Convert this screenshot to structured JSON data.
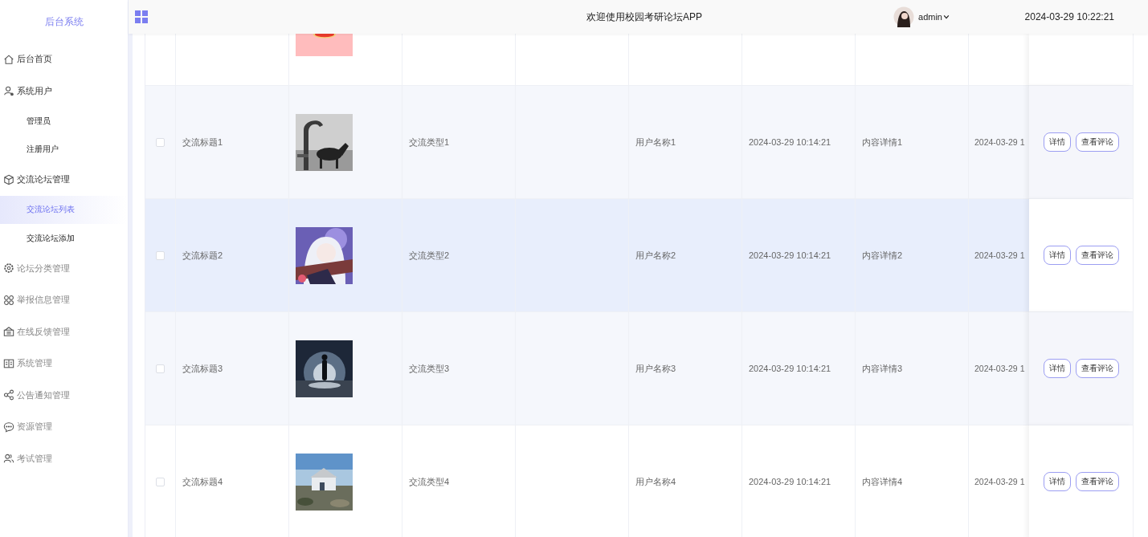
{
  "sidebar": {
    "title": "后台系统",
    "items": [
      {
        "label": "后台首页",
        "selected": false
      },
      {
        "label": "系统用户",
        "selected": false,
        "children": [
          {
            "label": "管理员",
            "selected": false
          },
          {
            "label": "注册用户",
            "selected": false
          }
        ]
      },
      {
        "label": "交流论坛管理",
        "selected": false,
        "children": [
          {
            "label": "交流论坛列表",
            "selected": true
          },
          {
            "label": "交流论坛添加",
            "selected": false
          }
        ]
      },
      {
        "label": "论坛分类管理",
        "selected": false
      },
      {
        "label": "举报信息管理",
        "selected": false
      },
      {
        "label": "在线反馈管理",
        "selected": false
      },
      {
        "label": "系统管理",
        "selected": false
      },
      {
        "label": "公告通知管理",
        "selected": false
      },
      {
        "label": "资源管理",
        "selected": false
      },
      {
        "label": "考试管理",
        "selected": false
      }
    ]
  },
  "header": {
    "title": "欢迎使用校园考研论坛APP",
    "user": "admin",
    "datetime": "2024-03-29 10:22:21"
  },
  "table": {
    "rows": [
      {
        "kind": "partial"
      },
      {
        "kind": "full",
        "checked": false,
        "hovered": false,
        "title": "交流标题1",
        "type": "交流类型1",
        "user": "用户名称1",
        "time": "2024-03-29 10:14:21",
        "content": "内容详情1",
        "time_2": "2024-03-29 1",
        "buttons": [
          "详情",
          "查看评论"
        ]
      },
      {
        "kind": "full",
        "checked": false,
        "hovered": true,
        "title": "交流标题2",
        "type": "交流类型2",
        "user": "用户名称2",
        "time": "2024-03-29 10:14:21",
        "content": "内容详情2",
        "time_2": "2024-03-29 1",
        "buttons": [
          "详情",
          "查看评论"
        ]
      },
      {
        "kind": "full",
        "checked": false,
        "hovered": false,
        "title": "交流标题3",
        "type": "交流类型3",
        "user": "用户名称3",
        "time": "2024-03-29 10:14:21",
        "content": "内容详情3",
        "time_2": "2024-03-29 1",
        "buttons": [
          "详情",
          "查看评论"
        ]
      },
      {
        "kind": "full",
        "checked": false,
        "hovered": false,
        "title": "交流标题4",
        "type": "交流类型4",
        "user": "用户名称4",
        "time": "2024-03-29 10:14:21",
        "content": "内容详情4",
        "time_2": "2024-03-29 1",
        "buttons": [
          "详情",
          "查看评论"
        ]
      }
    ]
  }
}
